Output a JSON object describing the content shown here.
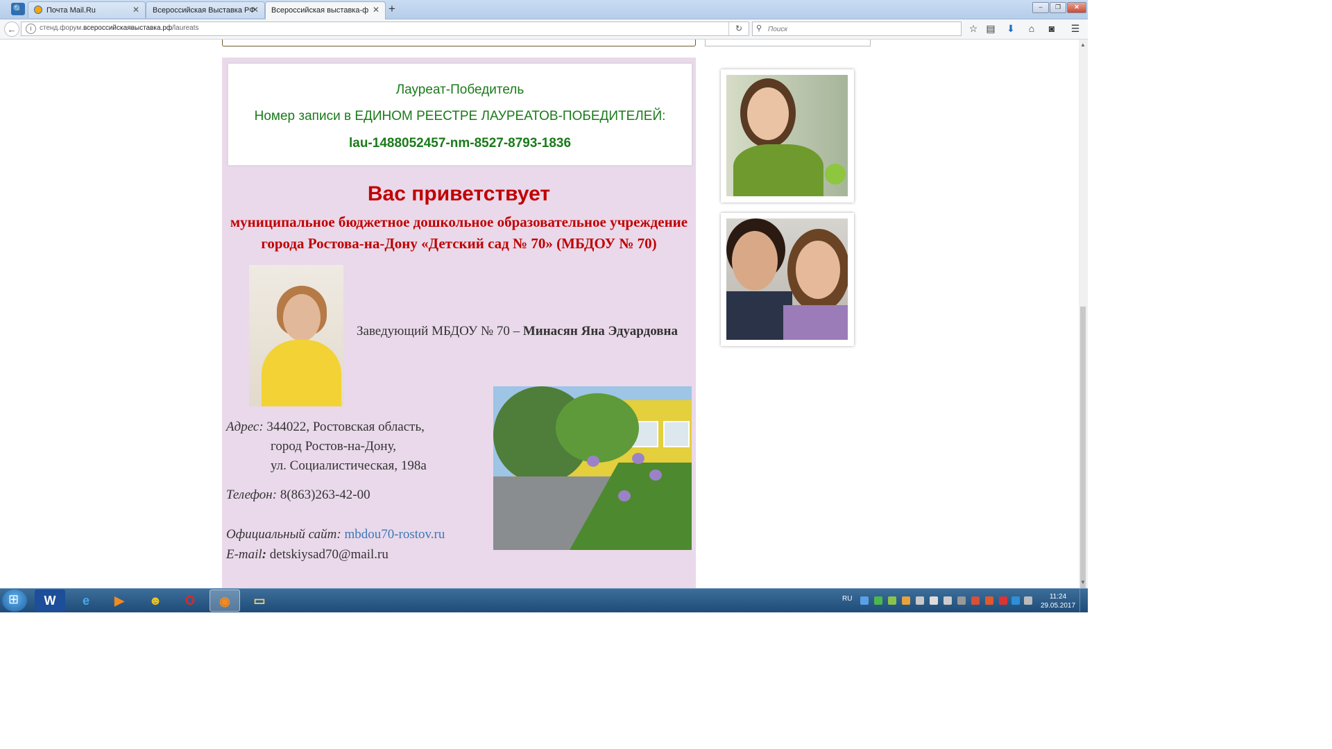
{
  "browser": {
    "tabs": [
      {
        "label": "Почта Mail.Ru",
        "active": false
      },
      {
        "label": "Всероссийская Выставка РФ",
        "active": false
      },
      {
        "label": "Всероссийская выставка-форум",
        "active": true
      }
    ],
    "url_prefix": "стенд.форум.",
    "url_domain": "всероссийскаявыставка.рф",
    "url_path": "/laureats",
    "search_placeholder": "Поиск"
  },
  "certificate": {
    "title": "Лауреат-Победитель",
    "registry_label": "Номер записи в ЕДИНОМ РЕЕСТРЕ ЛАУРЕАТОВ-ПОБЕДИТЕЛЕЙ:",
    "registry_number": "lau-1488052457-nm-8527-8793-1836"
  },
  "greeting": {
    "heading": "Вас приветствует",
    "org_line1": "муниципальное бюджетное дошкольное образовательное учреждение",
    "org_line2": "города Ростова-на-Дону «Детский сад № 70» (МБДОУ № 70)"
  },
  "director": {
    "role": "Заведующий МБДОУ № 70 – ",
    "name": "Минасян Яна Эдуардовна"
  },
  "contacts": {
    "address_label": "Адрес:",
    "address_line1": " 344022, Ростовская область,",
    "address_line2": "город Ростов-на-Дону,",
    "address_line3": "ул. Социалистическая, 198а",
    "phone_label": "Телефон:",
    "phone": " 8(863)263-42-00",
    "site_label": "Официальный сайт:",
    "site": "mbdou70-rostov.ru",
    "email_label": "E-mail",
    "email_colon": ":",
    "email": " detskiysad70@mail.ru"
  },
  "taskbar": {
    "language": "RU",
    "time": "11:24",
    "date": "29.05.2017"
  },
  "colors": {
    "page_bg": "#ead9ea",
    "green": "#1a7a1a",
    "red": "#c00000",
    "link": "#3a78b8"
  }
}
